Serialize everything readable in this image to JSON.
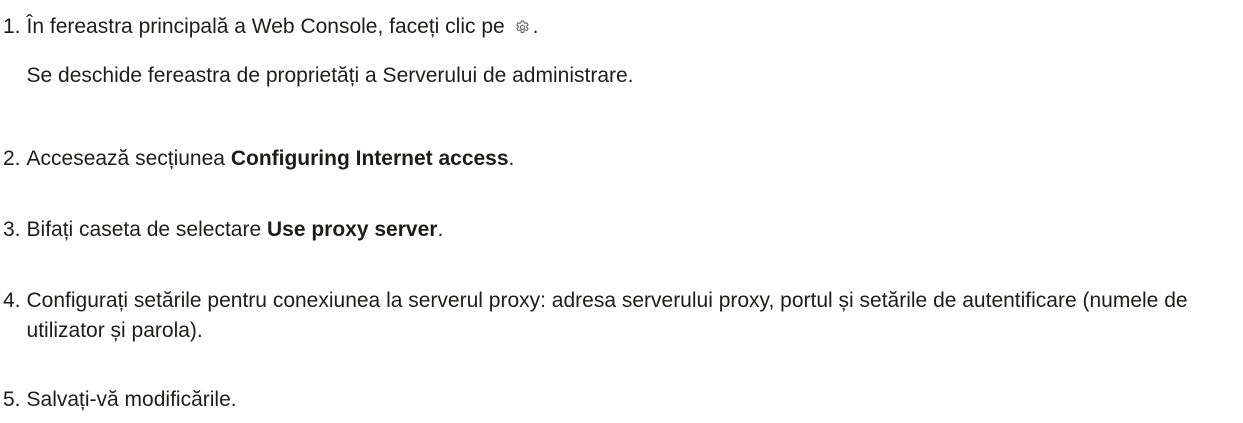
{
  "steps": [
    {
      "number": "1.",
      "before_icon": "În fereastra principală a Web Console, faceți clic pe",
      "icon": "gear-icon",
      "after_icon": ".",
      "result": "Se deschide fereastra de proprietăți a Serverului de administrare."
    },
    {
      "number": "2.",
      "before": "Accesează secțiunea",
      "bold": "Configuring Internet access",
      "after": "."
    },
    {
      "number": "3.",
      "before": "Bifați caseta de selectare",
      "bold": "Use proxy server",
      "after": "."
    },
    {
      "number": "4.",
      "text": "Configurați setările pentru conexiunea la serverul proxy: adresa serverului proxy, portul și setările de autentificare (numele de utilizator și parola)."
    },
    {
      "number": "5.",
      "text": "Salvați-vă modificările."
    }
  ]
}
